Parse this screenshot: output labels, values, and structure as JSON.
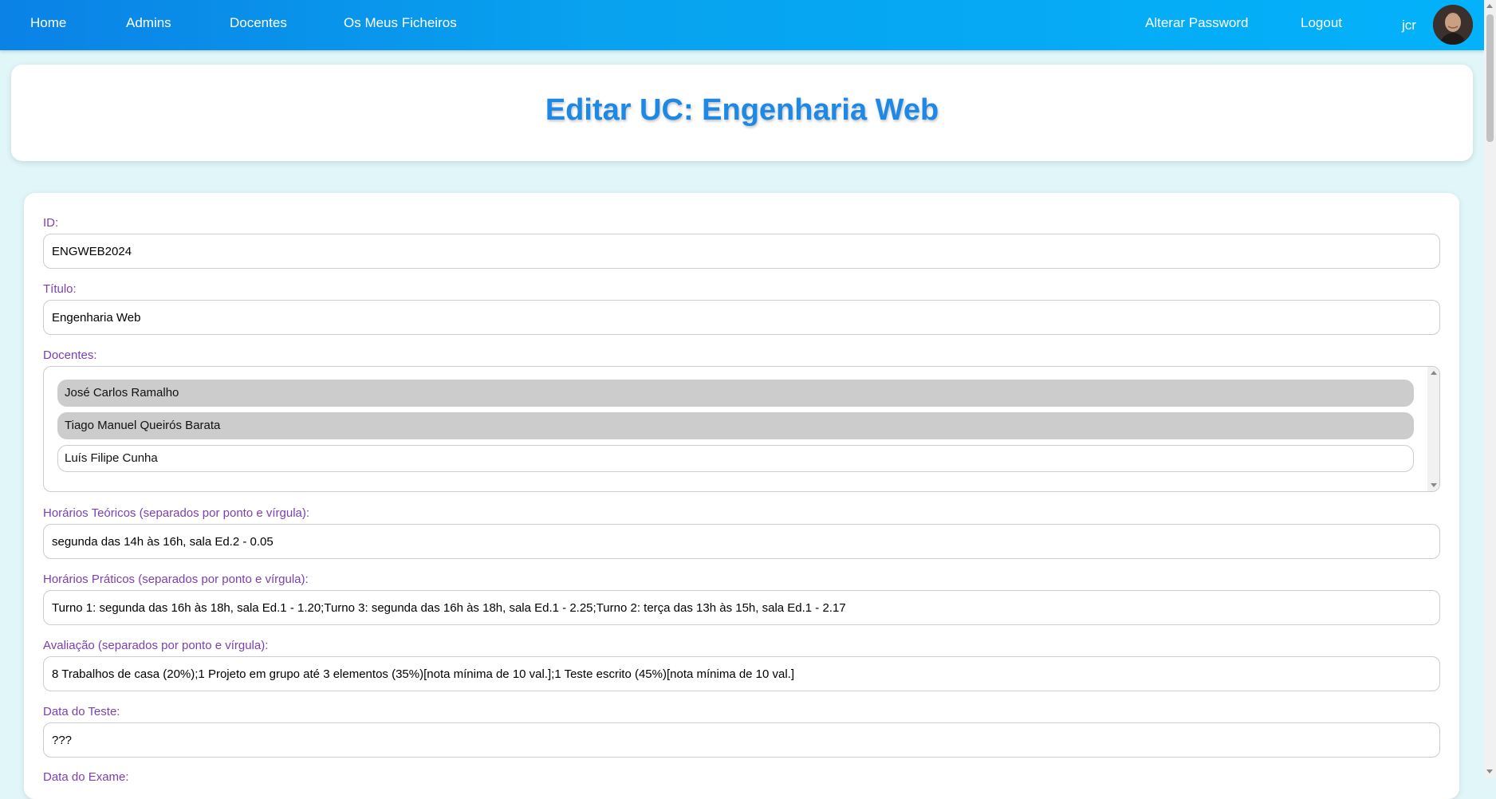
{
  "navbar": {
    "links": [
      "Home",
      "Admins",
      "Docentes",
      "Os Meus Ficheiros"
    ],
    "right_links": [
      "Alterar Password",
      "Logout"
    ],
    "username": "jcr"
  },
  "page": {
    "title": "Editar UC: Engenharia Web"
  },
  "form": {
    "id_label": "ID:",
    "id_value": "ENGWEB2024",
    "titulo_label": "Título:",
    "titulo_value": "Engenharia Web",
    "docentes_label": "Docentes:",
    "docentes_options": [
      {
        "label": "José Carlos Ramalho",
        "selected": true
      },
      {
        "label": "Tiago Manuel Queirós Barata",
        "selected": true
      },
      {
        "label": "Luís Filipe Cunha",
        "selected": false
      }
    ],
    "horarios_teoricos_label": "Horários Teóricos (separados por ponto e vírgula):",
    "horarios_teoricos_value": "segunda das 14h às 16h, sala Ed.2 - 0.05",
    "horarios_praticos_label": "Horários Práticos (separados por ponto e vírgula):",
    "horarios_praticos_value": "Turno 1: segunda das 16h às 18h, sala Ed.1 - 1.20;Turno 3: segunda das 16h às 18h, sala Ed.1 - 2.25;Turno 2: terça das 13h às 15h, sala Ed.1 - 2.17",
    "avaliacao_label": "Avaliação (separados por ponto e vírgula):",
    "avaliacao_value": "8 Trabalhos de casa (20%);1 Projeto em grupo até 3 elementos (35%)[nota mínima de 10 val.];1 Teste escrito (45%)[nota mínima de 10 val.]",
    "data_teste_label": "Data do Teste:",
    "data_teste_value": "???",
    "data_exame_label": "Data do Exame:"
  },
  "colors": {
    "accent": "#1e88e5",
    "label": "#7b3fb0",
    "nav_start": "#0a82e6",
    "nav_end": "#03b2fa",
    "background": "#e0f6f8"
  }
}
